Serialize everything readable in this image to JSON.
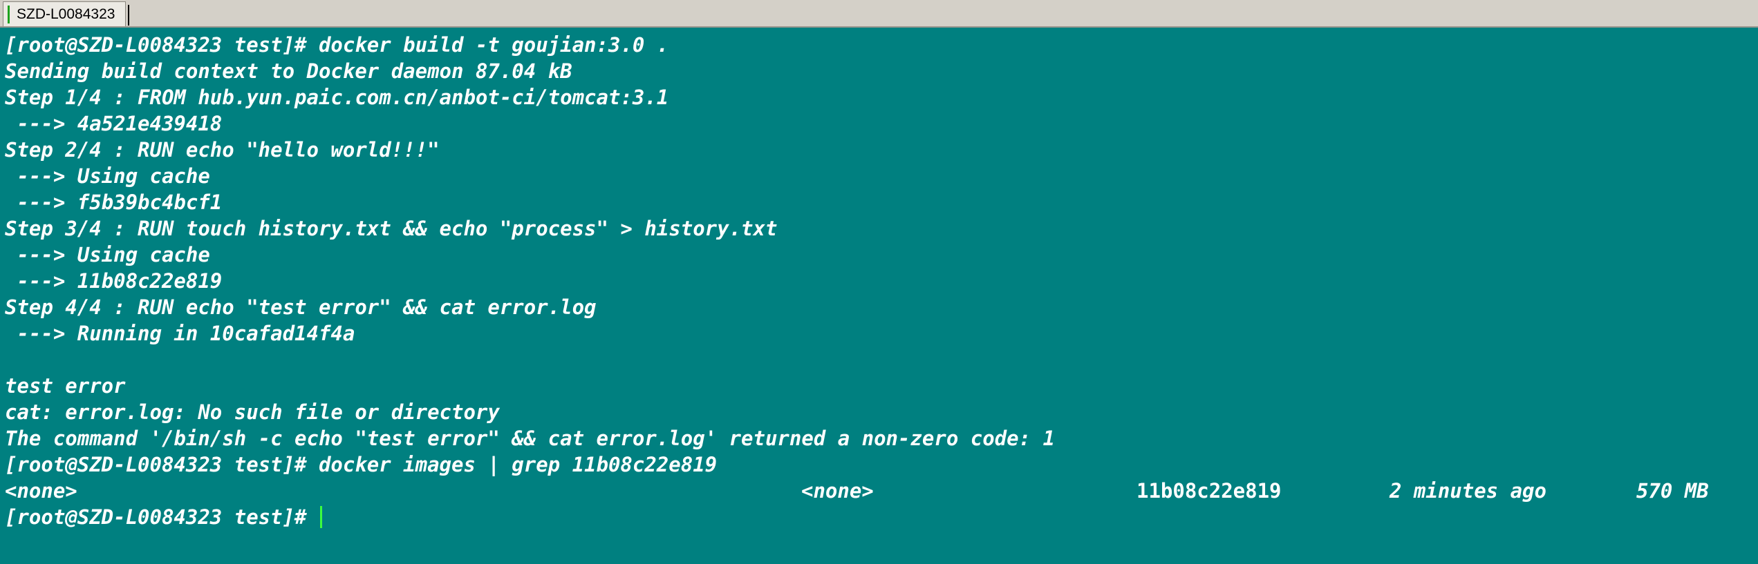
{
  "window": {
    "tab_label": "SZD-L0084323",
    "status_color": "#1ea21e"
  },
  "terminal": {
    "lines": [
      "[root@SZD-L0084323 test]# docker build -t goujian:3.0 .",
      "Sending build context to Docker daemon 87.04 kB",
      "Step 1/4 : FROM hub.yun.paic.com.cn/anbot-ci/tomcat:3.1",
      " ---> 4a521e439418",
      "Step 2/4 : RUN echo \"hello world!!!\"",
      " ---> Using cache",
      " ---> f5b39bc4bcf1",
      "Step 3/4 : RUN touch history.txt && echo \"process\" > history.txt",
      " ---> Using cache",
      " ---> 11b08c22e819",
      "Step 4/4 : RUN echo \"test error\" && cat error.log",
      " ---> Running in 10cafad14f4a",
      "",
      "test error",
      "cat: error.log: No such file or directory",
      "The command '/bin/sh -c echo \"test error\" && cat error.log' returned a non-zero code: 1",
      "[root@SZD-L0084323 test]# docker images | grep 11b08c22e819"
    ],
    "image_row": {
      "repository": "<none>",
      "tag": "<none>",
      "image_id": "11b08c22e819",
      "created": "2 minutes ago",
      "size": "570 MB"
    },
    "prompt": "[root@SZD-L0084323 test]# "
  }
}
